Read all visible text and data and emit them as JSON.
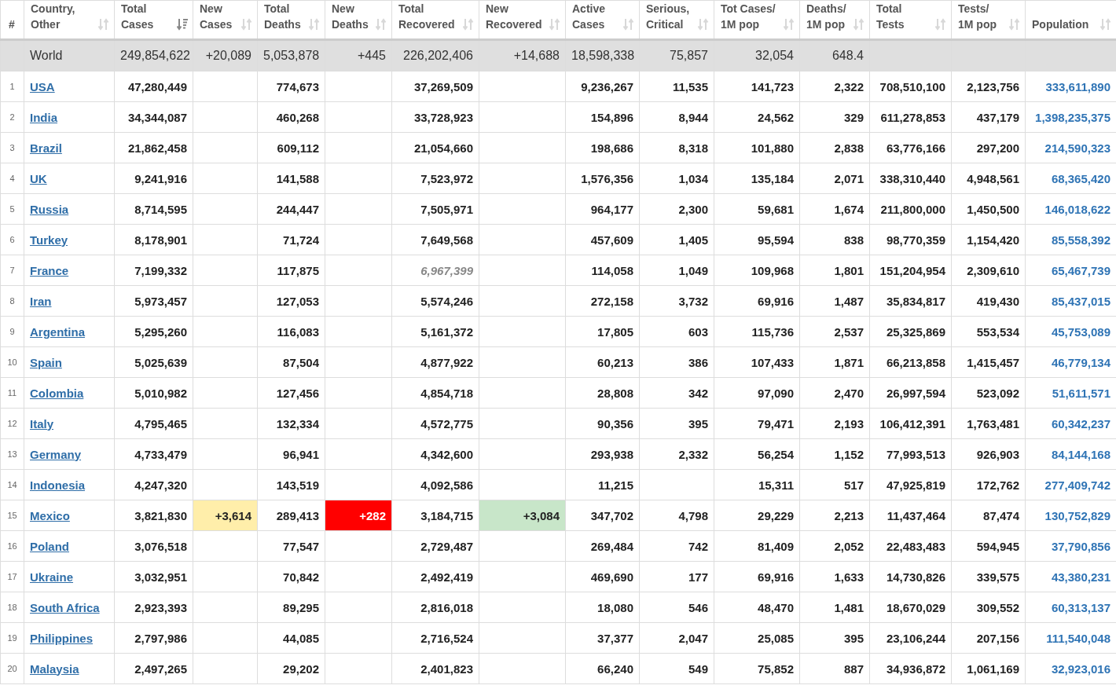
{
  "table": {
    "columns": [
      {
        "label": "#"
      },
      {
        "label": "Country,\nOther",
        "sorted": false
      },
      {
        "label": "Total\nCases",
        "sorted": true
      },
      {
        "label": "New\nCases",
        "sorted": false
      },
      {
        "label": "Total\nDeaths",
        "sorted": false
      },
      {
        "label": "New\nDeaths",
        "sorted": false
      },
      {
        "label": "Total\nRecovered",
        "sorted": false
      },
      {
        "label": "New\nRecovered",
        "sorted": false
      },
      {
        "label": "Active\nCases",
        "sorted": false
      },
      {
        "label": "Serious,\nCritical",
        "sorted": false
      },
      {
        "label": "Tot Cases/\n1M pop",
        "sorted": false
      },
      {
        "label": "Deaths/\n1M pop",
        "sorted": false
      },
      {
        "label": "Total\nTests",
        "sorted": false
      },
      {
        "label": "Tests/\n1M pop",
        "sorted": false
      },
      {
        "label": "Population",
        "sorted": false
      }
    ],
    "world": {
      "country": "World",
      "total_cases": "249,854,622",
      "new_cases": "+20,089",
      "total_deaths": "5,053,878",
      "new_deaths": "+445",
      "total_recovered": "226,202,406",
      "new_recovered": "+14,688",
      "active_cases": "18,598,338",
      "serious_critical": "75,857",
      "cases_per_1m": "32,054",
      "deaths_per_1m": "648.4"
    },
    "rows": [
      {
        "rank": "1",
        "country": "USA",
        "total_cases": "47,280,449",
        "total_deaths": "774,673",
        "total_recovered": "37,269,509",
        "recovered_estimated": false,
        "active_cases": "9,236,267",
        "serious_critical": "11,535",
        "cases_per_1m": "141,723",
        "deaths_per_1m": "2,322",
        "total_tests": "708,510,100",
        "tests_per_1m": "2,123,756",
        "population": "333,611,890"
      },
      {
        "rank": "2",
        "country": "India",
        "total_cases": "34,344,087",
        "total_deaths": "460,268",
        "total_recovered": "33,728,923",
        "recovered_estimated": false,
        "active_cases": "154,896",
        "serious_critical": "8,944",
        "cases_per_1m": "24,562",
        "deaths_per_1m": "329",
        "total_tests": "611,278,853",
        "tests_per_1m": "437,179",
        "population": "1,398,235,375"
      },
      {
        "rank": "3",
        "country": "Brazil",
        "total_cases": "21,862,458",
        "total_deaths": "609,112",
        "total_recovered": "21,054,660",
        "recovered_estimated": false,
        "active_cases": "198,686",
        "serious_critical": "8,318",
        "cases_per_1m": "101,880",
        "deaths_per_1m": "2,838",
        "total_tests": "63,776,166",
        "tests_per_1m": "297,200",
        "population": "214,590,323"
      },
      {
        "rank": "4",
        "country": "UK",
        "total_cases": "9,241,916",
        "total_deaths": "141,588",
        "total_recovered": "7,523,972",
        "recovered_estimated": false,
        "active_cases": "1,576,356",
        "serious_critical": "1,034",
        "cases_per_1m": "135,184",
        "deaths_per_1m": "2,071",
        "total_tests": "338,310,440",
        "tests_per_1m": "4,948,561",
        "population": "68,365,420"
      },
      {
        "rank": "5",
        "country": "Russia",
        "total_cases": "8,714,595",
        "total_deaths": "244,447",
        "total_recovered": "7,505,971",
        "recovered_estimated": false,
        "active_cases": "964,177",
        "serious_critical": "2,300",
        "cases_per_1m": "59,681",
        "deaths_per_1m": "1,674",
        "total_tests": "211,800,000",
        "tests_per_1m": "1,450,500",
        "population": "146,018,622"
      },
      {
        "rank": "6",
        "country": "Turkey",
        "total_cases": "8,178,901",
        "total_deaths": "71,724",
        "total_recovered": "7,649,568",
        "recovered_estimated": false,
        "active_cases": "457,609",
        "serious_critical": "1,405",
        "cases_per_1m": "95,594",
        "deaths_per_1m": "838",
        "total_tests": "98,770,359",
        "tests_per_1m": "1,154,420",
        "population": "85,558,392"
      },
      {
        "rank": "7",
        "country": "France",
        "total_cases": "7,199,332",
        "total_deaths": "117,875",
        "total_recovered": "6,967,399",
        "recovered_estimated": true,
        "active_cases": "114,058",
        "serious_critical": "1,049",
        "cases_per_1m": "109,968",
        "deaths_per_1m": "1,801",
        "total_tests": "151,204,954",
        "tests_per_1m": "2,309,610",
        "population": "65,467,739"
      },
      {
        "rank": "8",
        "country": "Iran",
        "total_cases": "5,973,457",
        "total_deaths": "127,053",
        "total_recovered": "5,574,246",
        "recovered_estimated": false,
        "active_cases": "272,158",
        "serious_critical": "3,732",
        "cases_per_1m": "69,916",
        "deaths_per_1m": "1,487",
        "total_tests": "35,834,817",
        "tests_per_1m": "419,430",
        "population": "85,437,015"
      },
      {
        "rank": "9",
        "country": "Argentina",
        "total_cases": "5,295,260",
        "total_deaths": "116,083",
        "total_recovered": "5,161,372",
        "recovered_estimated": false,
        "active_cases": "17,805",
        "serious_critical": "603",
        "cases_per_1m": "115,736",
        "deaths_per_1m": "2,537",
        "total_tests": "25,325,869",
        "tests_per_1m": "553,534",
        "population": "45,753,089"
      },
      {
        "rank": "10",
        "country": "Spain",
        "total_cases": "5,025,639",
        "total_deaths": "87,504",
        "total_recovered": "4,877,922",
        "recovered_estimated": false,
        "active_cases": "60,213",
        "serious_critical": "386",
        "cases_per_1m": "107,433",
        "deaths_per_1m": "1,871",
        "total_tests": "66,213,858",
        "tests_per_1m": "1,415,457",
        "population": "46,779,134"
      },
      {
        "rank": "11",
        "country": "Colombia",
        "total_cases": "5,010,982",
        "total_deaths": "127,456",
        "total_recovered": "4,854,718",
        "recovered_estimated": false,
        "active_cases": "28,808",
        "serious_critical": "342",
        "cases_per_1m": "97,090",
        "deaths_per_1m": "2,470",
        "total_tests": "26,997,594",
        "tests_per_1m": "523,092",
        "population": "51,611,571"
      },
      {
        "rank": "12",
        "country": "Italy",
        "total_cases": "4,795,465",
        "total_deaths": "132,334",
        "total_recovered": "4,572,775",
        "recovered_estimated": false,
        "active_cases": "90,356",
        "serious_critical": "395",
        "cases_per_1m": "79,471",
        "deaths_per_1m": "2,193",
        "total_tests": "106,412,391",
        "tests_per_1m": "1,763,481",
        "population": "60,342,237"
      },
      {
        "rank": "13",
        "country": "Germany",
        "total_cases": "4,733,479",
        "total_deaths": "96,941",
        "total_recovered": "4,342,600",
        "recovered_estimated": false,
        "active_cases": "293,938",
        "serious_critical": "2,332",
        "cases_per_1m": "56,254",
        "deaths_per_1m": "1,152",
        "total_tests": "77,993,513",
        "tests_per_1m": "926,903",
        "population": "84,144,168"
      },
      {
        "rank": "14",
        "country": "Indonesia",
        "total_cases": "4,247,320",
        "total_deaths": "143,519",
        "total_recovered": "4,092,586",
        "recovered_estimated": false,
        "active_cases": "11,215",
        "cases_per_1m": "15,311",
        "deaths_per_1m": "517",
        "total_tests": "47,925,819",
        "tests_per_1m": "172,762",
        "population": "277,409,742"
      },
      {
        "rank": "15",
        "country": "Mexico",
        "total_cases": "3,821,830",
        "new_cases": {
          "value": "+3,614",
          "color": "#ffeeaa"
        },
        "total_deaths": "289,413",
        "new_deaths": {
          "value": "+282",
          "color": "#ff0000"
        },
        "total_recovered": "3,184,715",
        "recovered_estimated": false,
        "new_recovered": {
          "value": "+3,084",
          "color": "#c8e6c9"
        },
        "active_cases": "347,702",
        "serious_critical": "4,798",
        "cases_per_1m": "29,229",
        "deaths_per_1m": "2,213",
        "total_tests": "11,437,464",
        "tests_per_1m": "87,474",
        "population": "130,752,829"
      },
      {
        "rank": "16",
        "country": "Poland",
        "total_cases": "3,076,518",
        "total_deaths": "77,547",
        "total_recovered": "2,729,487",
        "recovered_estimated": false,
        "active_cases": "269,484",
        "serious_critical": "742",
        "cases_per_1m": "81,409",
        "deaths_per_1m": "2,052",
        "total_tests": "22,483,483",
        "tests_per_1m": "594,945",
        "population": "37,790,856"
      },
      {
        "rank": "17",
        "country": "Ukraine",
        "total_cases": "3,032,951",
        "total_deaths": "70,842",
        "total_recovered": "2,492,419",
        "recovered_estimated": false,
        "active_cases": "469,690",
        "serious_critical": "177",
        "cases_per_1m": "69,916",
        "deaths_per_1m": "1,633",
        "total_tests": "14,730,826",
        "tests_per_1m": "339,575",
        "population": "43,380,231"
      },
      {
        "rank": "18",
        "country": "South Africa",
        "total_cases": "2,923,393",
        "total_deaths": "89,295",
        "total_recovered": "2,816,018",
        "recovered_estimated": false,
        "active_cases": "18,080",
        "serious_critical": "546",
        "cases_per_1m": "48,470",
        "deaths_per_1m": "1,481",
        "total_tests": "18,670,029",
        "tests_per_1m": "309,552",
        "population": "60,313,137"
      },
      {
        "rank": "19",
        "country": "Philippines",
        "total_cases": "2,797,986",
        "total_deaths": "44,085",
        "total_recovered": "2,716,524",
        "recovered_estimated": false,
        "active_cases": "37,377",
        "serious_critical": "2,047",
        "cases_per_1m": "25,085",
        "deaths_per_1m": "395",
        "total_tests": "23,106,244",
        "tests_per_1m": "207,156",
        "population": "111,540,048"
      },
      {
        "rank": "20",
        "country": "Malaysia",
        "total_cases": "2,497,265",
        "total_deaths": "29,202",
        "total_recovered": "2,401,823",
        "recovered_estimated": false,
        "active_cases": "66,240",
        "serious_critical": "549",
        "cases_per_1m": "75,852",
        "deaths_per_1m": "887",
        "total_tests": "34,936,872",
        "tests_per_1m": "1,061,169",
        "population": "32,923,016"
      }
    ]
  }
}
